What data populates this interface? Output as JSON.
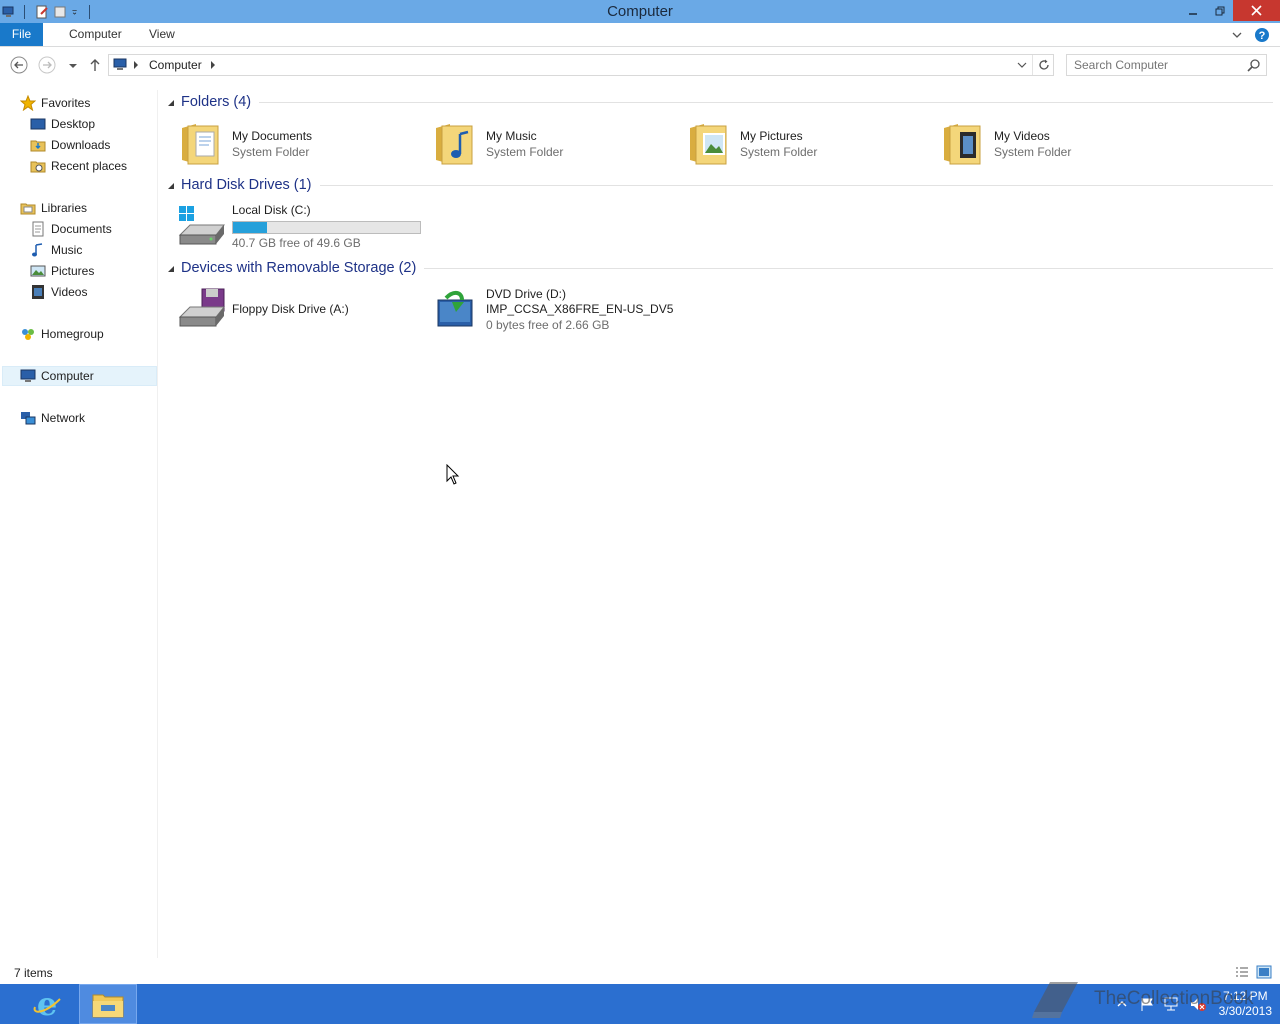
{
  "window": {
    "title": "Computer"
  },
  "ribbon": {
    "tabs": [
      "File",
      "Computer",
      "View"
    ]
  },
  "address": {
    "crumb": "Computer"
  },
  "search": {
    "placeholder": "Search Computer"
  },
  "navpane": {
    "favorites": {
      "label": "Favorites",
      "items": [
        "Desktop",
        "Downloads",
        "Recent places"
      ]
    },
    "libraries": {
      "label": "Libraries",
      "items": [
        "Documents",
        "Music",
        "Pictures",
        "Videos"
      ]
    },
    "homegroup": "Homegroup",
    "computer": "Computer",
    "network": "Network"
  },
  "groups": {
    "folders": {
      "title": "Folders (4)",
      "items": [
        {
          "name": "My Documents",
          "sub": "System Folder",
          "icon": "documents-folder-icon"
        },
        {
          "name": "My Music",
          "sub": "System Folder",
          "icon": "music-folder-icon"
        },
        {
          "name": "My Pictures",
          "sub": "System Folder",
          "icon": "pictures-folder-icon"
        },
        {
          "name": "My Videos",
          "sub": "System Folder",
          "icon": "videos-folder-icon"
        }
      ]
    },
    "hdd": {
      "title": "Hard Disk Drives (1)",
      "items": [
        {
          "name": "Local Disk (C:)",
          "free": "40.7 GB free of 49.6 GB",
          "used_fraction": 0.18,
          "icon": "local-disk-icon"
        }
      ]
    },
    "removable": {
      "title": "Devices with Removable Storage (2)",
      "items": [
        {
          "name": "Floppy Disk Drive (A:)",
          "icon": "floppy-drive-icon"
        },
        {
          "name": "DVD Drive (D:)",
          "label": "IMP_CCSA_X86FRE_EN-US_DV5",
          "free": "0 bytes free of 2.66 GB",
          "icon": "dvd-drive-icon"
        }
      ]
    }
  },
  "status": {
    "count": "7 items"
  },
  "taskbar": {
    "time": "7:12 PM",
    "date": "3/30/2013"
  },
  "watermark": "TheCollectionBook",
  "colors": {
    "titlebar": "#6aa9e6",
    "file_tab": "#1979ca",
    "taskbar": "#2b6fd0",
    "group_title": "#1e3287",
    "bar_fill": "#26a0da",
    "close": "#c7372f"
  }
}
